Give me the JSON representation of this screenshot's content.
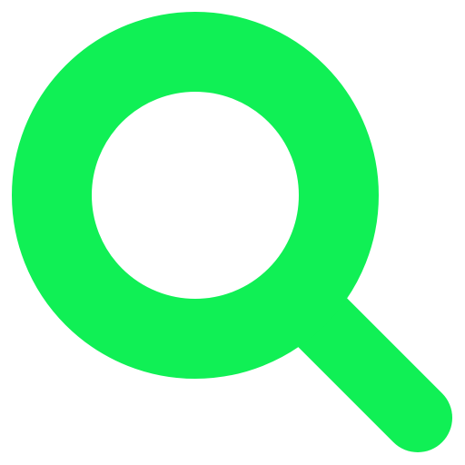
{
  "icon": {
    "name": "search-icon",
    "color": "#10f055",
    "background": "#ffffff"
  }
}
